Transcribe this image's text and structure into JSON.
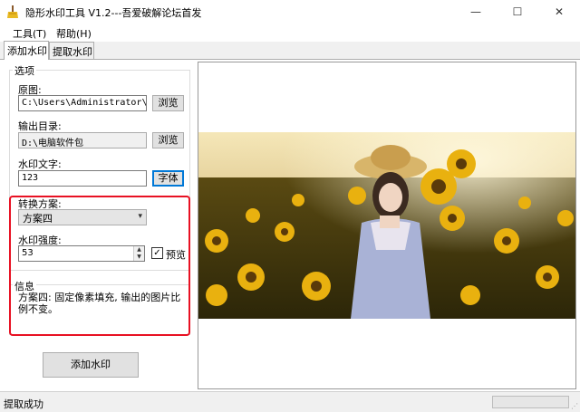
{
  "window": {
    "title": "隐形水印工具 V1.2---吾爱破解论坛首发",
    "minimize": "—",
    "maximize": "☐",
    "close": "✕"
  },
  "menu": {
    "items": [
      {
        "label": "工具(T)"
      },
      {
        "label": "帮助(H)"
      }
    ]
  },
  "tabs": [
    {
      "label": "添加水印",
      "active": true
    },
    {
      "label": "提取水印",
      "active": false
    }
  ],
  "options": {
    "legend": "选项",
    "source_label": "原图:",
    "source_value": "C:\\Users\\Administrator\\Pict",
    "browse_label": "浏览",
    "output_label": "输出目录:",
    "output_value": "D:\\电脑软件包",
    "browse2_label": "浏览",
    "watermark_text_label": "水印文字:",
    "watermark_text_value": "123",
    "font_button_label": "字体",
    "scheme_label": "转换方案:",
    "scheme_value": "方案四",
    "strength_label": "水印强度:",
    "strength_value": "53",
    "preview_label": "预览",
    "preview_checked": true
  },
  "info": {
    "legend": "信息",
    "text": "方案四: 固定像素填充, 输出的图片比例不变。"
  },
  "actions": {
    "add_watermark_label": "添加水印"
  },
  "status": {
    "text": "提取成功",
    "progress": 0
  },
  "colors": {
    "highlight": "#e81123",
    "focus": "#0078d7"
  }
}
